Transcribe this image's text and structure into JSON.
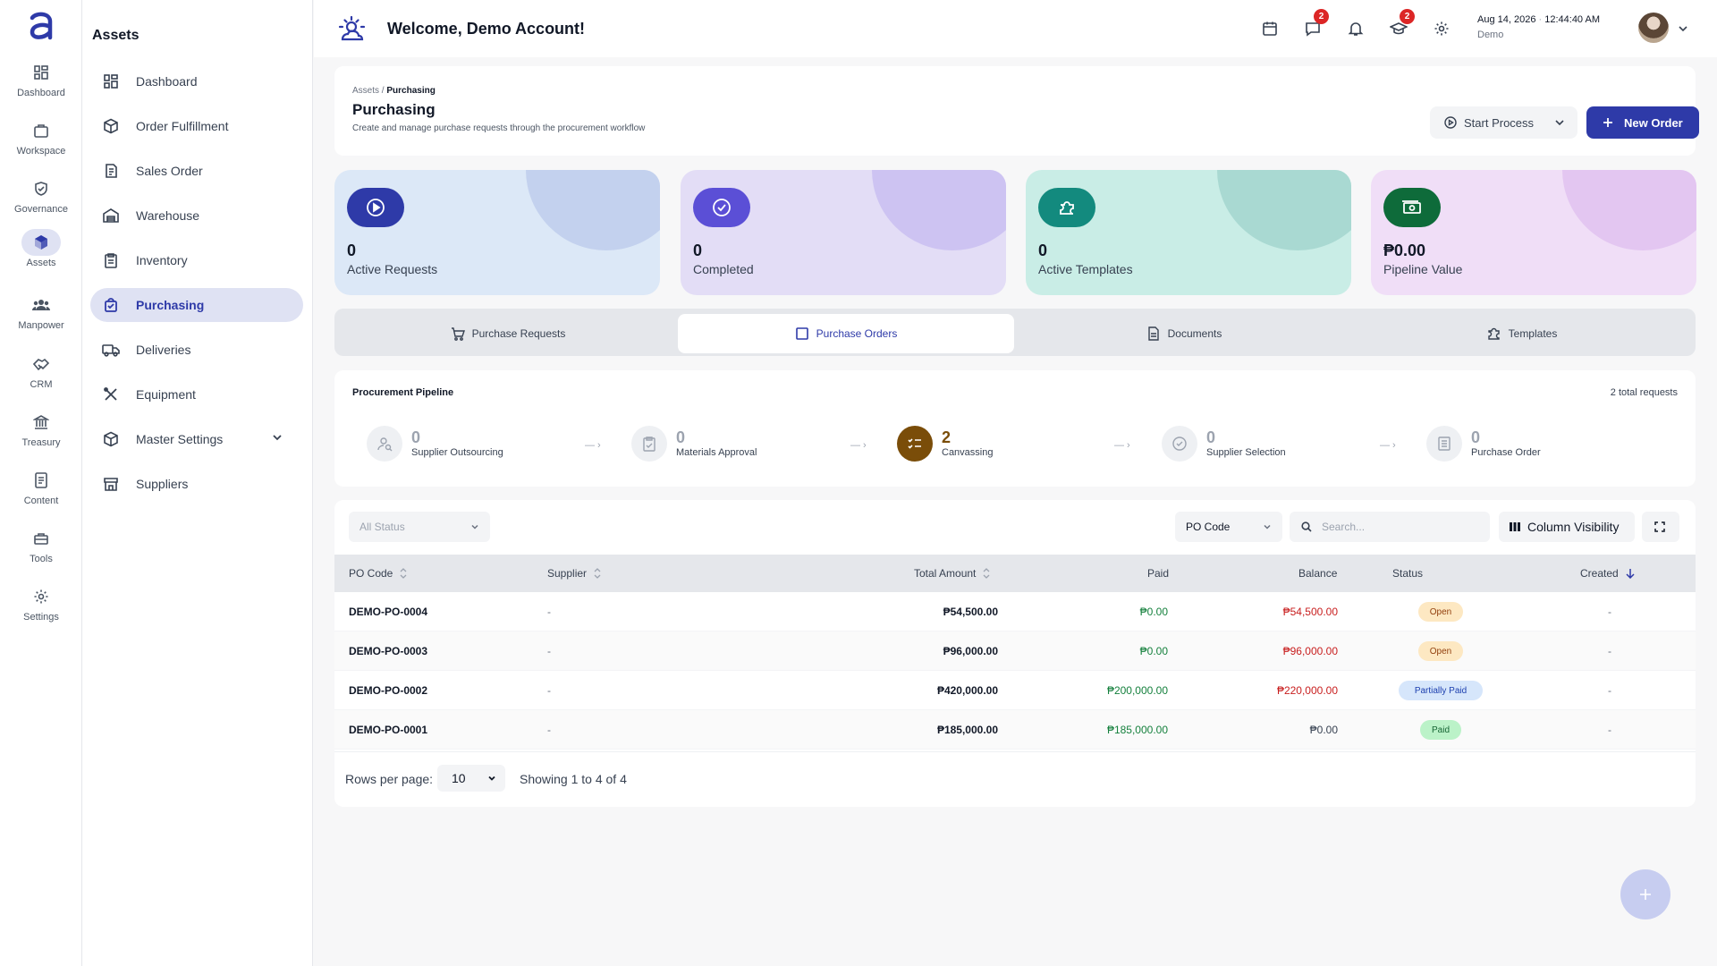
{
  "rail": [
    {
      "label": "Dashboard",
      "icon": "grid-icon"
    },
    {
      "label": "Workspace",
      "icon": "briefcase-icon"
    },
    {
      "label": "Governance",
      "icon": "shield-check-icon"
    },
    {
      "label": "Assets",
      "icon": "cube-icon",
      "active": true
    },
    {
      "label": "Manpower",
      "icon": "users-icon"
    },
    {
      "label": "CRM",
      "icon": "handshake-icon"
    },
    {
      "label": "Treasury",
      "icon": "bank-icon"
    },
    {
      "label": "Content",
      "icon": "document-icon"
    },
    {
      "label": "Tools",
      "icon": "toolbox-icon"
    },
    {
      "label": "Settings",
      "icon": "gear-icon"
    }
  ],
  "sidebar": {
    "title": "Assets",
    "items": [
      {
        "label": "Dashboard",
        "icon": "grid-icon"
      },
      {
        "label": "Order Fulfillment",
        "icon": "package-icon"
      },
      {
        "label": "Sales Order",
        "icon": "receipt-icon"
      },
      {
        "label": "Warehouse",
        "icon": "warehouse-icon"
      },
      {
        "label": "Inventory",
        "icon": "clipboard-icon"
      },
      {
        "label": "Purchasing",
        "icon": "shopping-bag-icon",
        "active": true
      },
      {
        "label": "Deliveries",
        "icon": "truck-icon"
      },
      {
        "label": "Equipment",
        "icon": "tools-icon"
      },
      {
        "label": "Master Settings",
        "icon": "cube-icon"
      },
      {
        "label": "Suppliers",
        "icon": "store-icon"
      }
    ]
  },
  "header": {
    "welcome": "Welcome, Demo Account!",
    "messages_badge": "2",
    "learning_badge": "2",
    "date": "Aug 14, 2026",
    "time": "12:44:40 AM",
    "user": "Demo"
  },
  "page": {
    "breadcrumb_parent": "Assets",
    "breadcrumb_current": "Purchasing",
    "title": "Purchasing",
    "subtitle": "Create and manage purchase requests through the procurement workflow",
    "start_process": "Start Process",
    "new_order": "New Order"
  },
  "stats": [
    {
      "value": "0",
      "label": "Active Requests",
      "bg": "#dce8f7",
      "blob": "#c3d1ee",
      "icon_bg": "#2e3aa8",
      "icon": "play-circle-icon"
    },
    {
      "value": "0",
      "label": "Completed",
      "bg": "#e3ddf6",
      "blob": "#cdc3f2",
      "icon_bg": "#5b4fd6",
      "icon": "check-circle-icon"
    },
    {
      "value": "0",
      "label": "Active Templates",
      "bg": "#c9ede6",
      "blob": "#a9d9d2",
      "icon_bg": "#138a7e",
      "icon": "puzzle-icon"
    },
    {
      "value": "₱0.00",
      "label": "Pipeline Value",
      "bg": "#f0def7",
      "blob": "#e3c6f1",
      "icon_bg": "#0e6b3a",
      "icon": "money-icon"
    }
  ],
  "tabs": [
    {
      "label": "Purchase Requests",
      "icon": "cart-icon"
    },
    {
      "label": "Purchase Orders",
      "icon": "square-icon",
      "active": true
    },
    {
      "label": "Documents",
      "icon": "document-icon"
    },
    {
      "label": "Templates",
      "icon": "puzzle-icon"
    }
  ],
  "pipeline": {
    "title": "Procurement Pipeline",
    "total": "2 total requests",
    "stages": [
      {
        "count": "0",
        "label": "Supplier Outsourcing",
        "icon": "user-search-icon"
      },
      {
        "count": "0",
        "label": "Materials Approval",
        "icon": "clipboard-check-icon"
      },
      {
        "count": "2",
        "label": "Canvassing",
        "icon": "list-check-icon",
        "active": true
      },
      {
        "count": "0",
        "label": "Supplier Selection",
        "icon": "badge-check-icon"
      },
      {
        "count": "0",
        "label": "Purchase Order",
        "icon": "list-icon"
      }
    ]
  },
  "filters": {
    "status": "All Status",
    "field": "PO Code",
    "search_placeholder": "Search...",
    "column_visibility": "Column Visibility"
  },
  "table": {
    "headers": {
      "po_code": "PO Code",
      "supplier": "Supplier",
      "total": "Total Amount",
      "paid": "Paid",
      "balance": "Balance",
      "status": "Status",
      "created": "Created"
    },
    "rows": [
      {
        "po_code": "DEMO-PO-0004",
        "supplier": "-",
        "total": "₱54,500.00",
        "paid": "₱0.00",
        "balance": "₱54,500.00",
        "status": "Open",
        "created": "-"
      },
      {
        "po_code": "DEMO-PO-0003",
        "supplier": "-",
        "total": "₱96,000.00",
        "paid": "₱0.00",
        "balance": "₱96,000.00",
        "status": "Open",
        "created": "-"
      },
      {
        "po_code": "DEMO-PO-0002",
        "supplier": "-",
        "total": "₱420,000.00",
        "paid": "₱200,000.00",
        "balance": "₱220,000.00",
        "status": "Partially Paid",
        "created": "-"
      },
      {
        "po_code": "DEMO-PO-0001",
        "supplier": "-",
        "total": "₱185,000.00",
        "paid": "₱185,000.00",
        "balance": "₱0.00",
        "status": "Paid",
        "created": "-"
      }
    ]
  },
  "pagination": {
    "rows_label": "Rows per page:",
    "rows_value": "10",
    "showing": "Showing 1 to 4 of 4"
  },
  "colors": {
    "primary": "#2e3aa8",
    "paid_green": "#15803d",
    "balance_red": "#c81e1e"
  }
}
